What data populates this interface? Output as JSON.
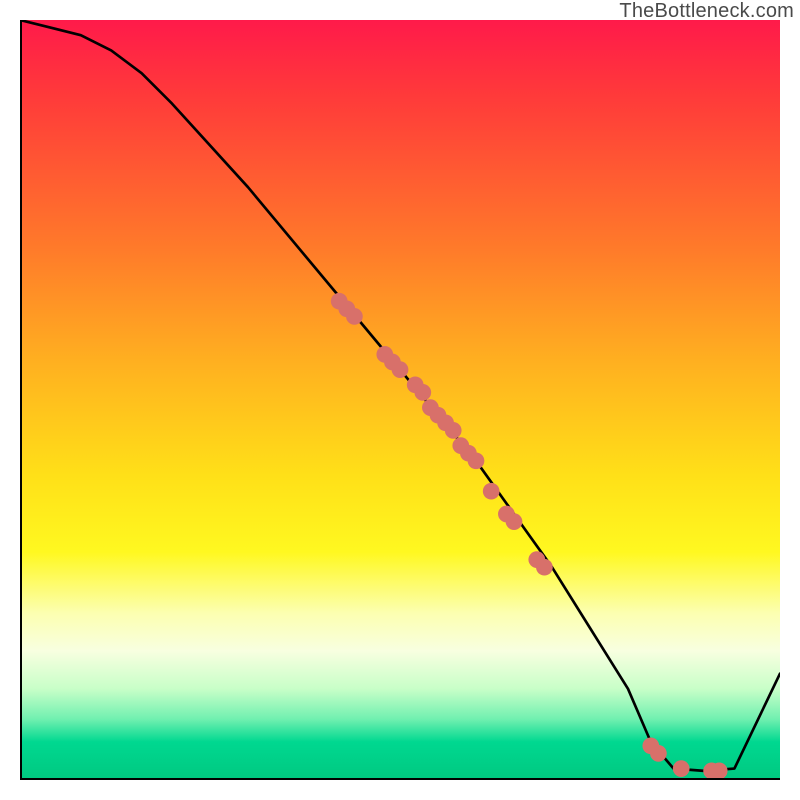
{
  "watermark": "TheBottleneck.com",
  "chart_data": {
    "type": "line",
    "title": "",
    "xlabel": "",
    "ylabel": "",
    "xlim": [
      0,
      100
    ],
    "ylim": [
      0,
      100
    ],
    "series": [
      {
        "name": "bottleneck-curve",
        "x": [
          0,
          4,
          8,
          12,
          16,
          20,
          30,
          40,
          50,
          55,
          60,
          65,
          70,
          75,
          80,
          83,
          86,
          90,
          94,
          100
        ],
        "y": [
          100,
          99,
          98,
          96,
          93,
          89,
          78,
          66,
          54,
          48,
          42,
          35,
          28,
          20,
          12,
          5,
          1.5,
          1.2,
          1.5,
          14
        ]
      }
    ],
    "scatter_points": {
      "name": "marked-points",
      "color": "#d8706a",
      "x": [
        42,
        43,
        44,
        48,
        49,
        50,
        52,
        53,
        54,
        55,
        56,
        57,
        58,
        59,
        60,
        62,
        64,
        65,
        68,
        69,
        83,
        84,
        87,
        91,
        92
      ],
      "y": [
        63,
        62,
        61,
        56,
        55,
        54,
        52,
        51,
        49,
        48,
        47,
        46,
        44,
        43,
        42,
        38,
        35,
        34,
        29,
        28,
        4.5,
        3.5,
        1.5,
        1.2,
        1.2
      ]
    },
    "colors": {
      "curve": "#000000",
      "points": "#d8706a",
      "gradient_top": "#ff1a4a",
      "gradient_bottom": "#00c880"
    }
  }
}
